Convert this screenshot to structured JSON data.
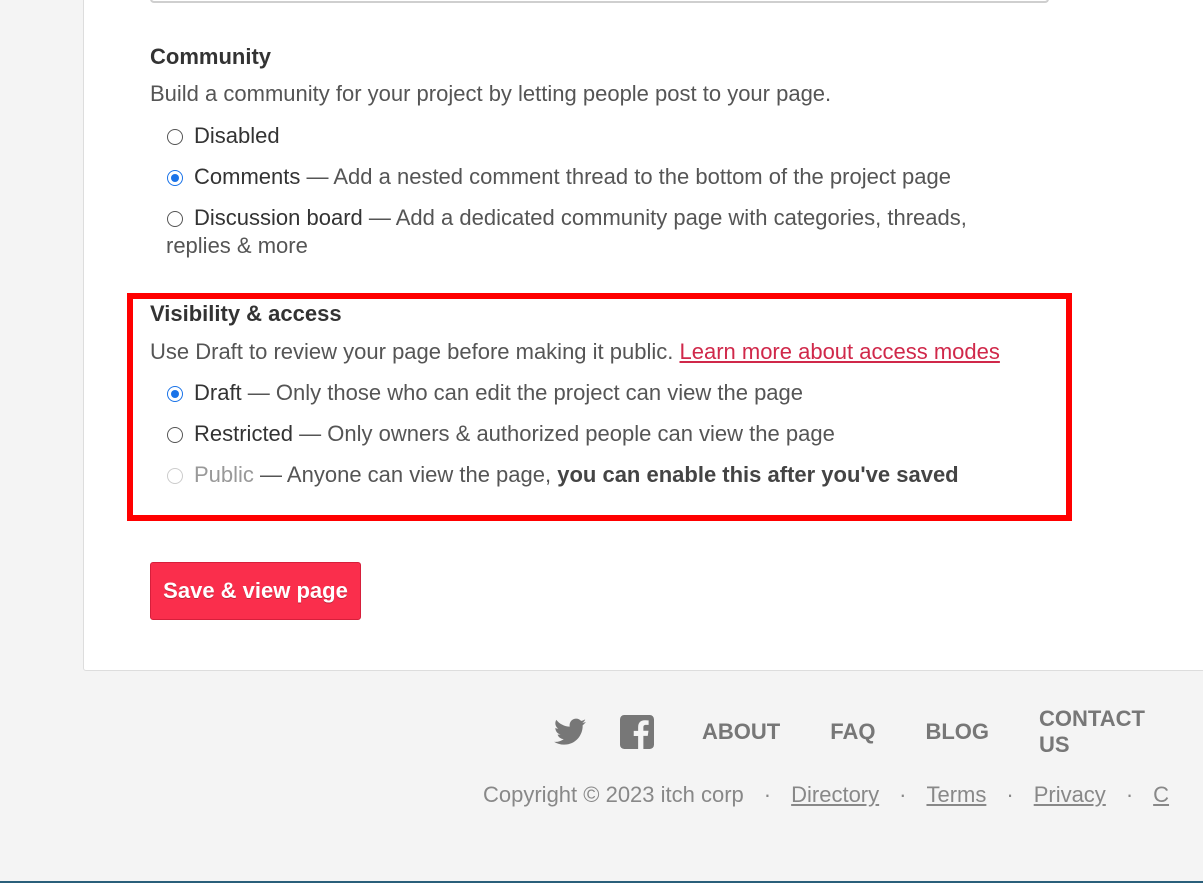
{
  "community": {
    "label": "Community",
    "description": "Build a community for your project by letting people post to your page.",
    "options": [
      {
        "name": "Disabled",
        "detail": "",
        "checked": false
      },
      {
        "name": "Comments",
        "detail": " — Add a nested comment thread to the bottom of the project page",
        "checked": true
      },
      {
        "name": "Discussion board",
        "detail": " — Add a dedicated community page with categories, threads, replies & more",
        "checked": false
      }
    ]
  },
  "visibility": {
    "label": "Visibility & access",
    "description": "Use Draft to review your page before making it public.",
    "link_text": "Learn more about access modes",
    "options": [
      {
        "name": "Draft",
        "detail": " — Only those who can edit the project can view the page",
        "checked": true
      },
      {
        "name": "Restricted",
        "detail": " — Only owners & authorized people can view the page",
        "checked": false
      },
      {
        "name": "Public",
        "detail": " — Anyone can view the page, ",
        "detail_bold": "you can enable this after you've saved",
        "checked": false,
        "disabled": true
      }
    ]
  },
  "save_button": "Save & view page",
  "footer": {
    "nav": [
      "ABOUT",
      "FAQ",
      "BLOG",
      "CONTACT US"
    ],
    "copyright": "Copyright © 2023 itch corp",
    "links": [
      "Directory",
      "Terms",
      "Privacy",
      "C"
    ],
    "icons": [
      "twitter-icon",
      "facebook-icon"
    ]
  },
  "colors": {
    "accent": "#fa2e4c",
    "radio_checked": "#1a73e8",
    "highlight": "#ff0000",
    "link": "#d0284a"
  }
}
